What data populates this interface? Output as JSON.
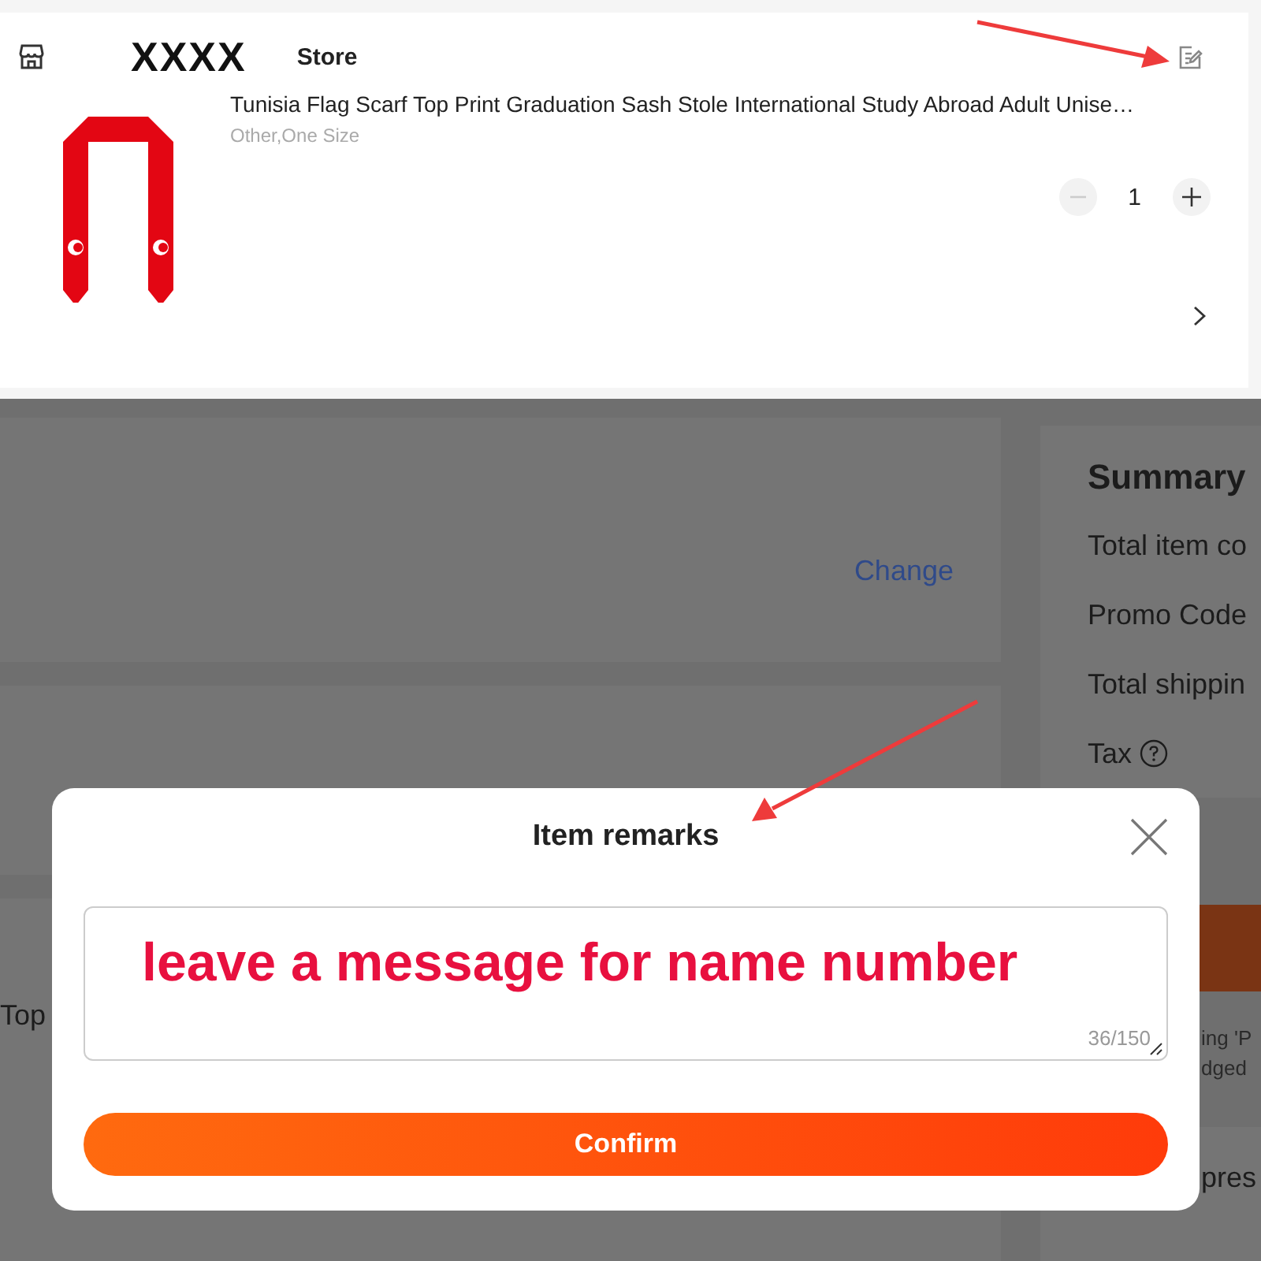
{
  "store": {
    "name": "XXXX",
    "label": "Store"
  },
  "item": {
    "title": "Tunisia Flag Scarf Top Print Graduation Sash Stole International Study Abroad Adult Unise…",
    "variant": "Other,One Size",
    "quantity": "1",
    "decrease_disabled": true
  },
  "background": {
    "change_link": "Change",
    "left_text": "Top",
    "summary_title": "Summary",
    "summary_rows": [
      {
        "label": "Total item co",
        "help": false
      },
      {
        "label": "Promo Code",
        "help": false
      },
      {
        "label": "Total shippin",
        "help": false
      },
      {
        "label": "Tax",
        "help": true
      }
    ],
    "notes": [
      "ing 'P",
      "dged"
    ],
    "section_title": "pres"
  },
  "modal": {
    "title": "Item remarks",
    "value": "leave a message for name number",
    "counter": "36/150",
    "confirm": "Confirm"
  }
}
